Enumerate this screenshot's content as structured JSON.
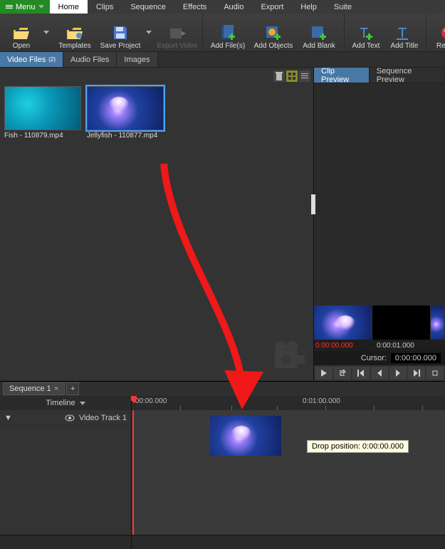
{
  "menu": {
    "label": "Menu"
  },
  "menuTabs": [
    "Home",
    "Clips",
    "Sequence",
    "Effects",
    "Audio",
    "Export",
    "Help",
    "Suite"
  ],
  "activeMenuTab": 0,
  "ribbon": {
    "open": "Open",
    "templates": "Templates",
    "save": "Save Project",
    "export": "Export Video",
    "addFiles": "Add File(s)",
    "addObjects": "Add Objects",
    "addBlank": "Add Blank",
    "addText": "Add Text",
    "addTitle": "Add Title",
    "record": "Record"
  },
  "fileTabs": {
    "video": "Video Files",
    "videoCount": "(2)",
    "audio": "Audio Files",
    "images": "Images"
  },
  "thumbs": [
    {
      "label": "Fish - 110879.mp4",
      "style": "fish-bg",
      "selected": false
    },
    {
      "label": "Jellyfish - 110877.mp4",
      "style": "jelly-bg",
      "selected": true
    }
  ],
  "preview": {
    "clipTab": "Clip Preview",
    "seqTab": "Sequence Preview",
    "t0": "0:00:00.000",
    "t1": "0:00:01.000",
    "cursorLabel": "Cursor:",
    "cursorVal": "0:00:00.000"
  },
  "sequence": {
    "tab": "Sequence 1",
    "timeline": "Timeline",
    "ruler0": ":00:00.000",
    "ruler1": "0:01:00.000",
    "track": "Video Track 1",
    "dropTip": "Drop position: 0:00:00.000"
  }
}
